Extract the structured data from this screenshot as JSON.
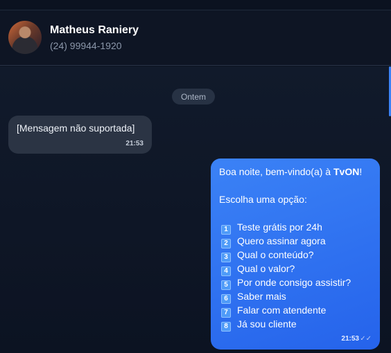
{
  "header": {
    "name": "Matheus Raniery",
    "phone": "(24) 99944-1920"
  },
  "chat": {
    "date_chip": "Ontem",
    "incoming": {
      "text": "[Mensagem não suportada]",
      "time": "21:53"
    },
    "outgoing": {
      "greeting_prefix": "Boa noite, bem-vindo(a) à ",
      "brand": "TvON",
      "greeting_suffix": "!",
      "prompt": "Escolha uma opção:",
      "options": [
        {
          "num": "1",
          "label": "Teste grátis por 24h"
        },
        {
          "num": "2",
          "label": "Quero assinar agora"
        },
        {
          "num": "3",
          "label": "Qual o conteúdo?"
        },
        {
          "num": "4",
          "label": "Qual o valor?"
        },
        {
          "num": "5",
          "label": "Por onde consigo assistir?"
        },
        {
          "num": "6",
          "label": "Saber mais"
        },
        {
          "num": "7",
          "label": "Falar com atendente"
        },
        {
          "num": "8",
          "label": "Já sou cliente"
        }
      ],
      "time": "21:53",
      "status_icon": "double-check-icon"
    }
  },
  "colors": {
    "background": "#0b1220",
    "incoming_bubble": "#2b3444",
    "outgoing_bubble": "#3b82f6"
  }
}
